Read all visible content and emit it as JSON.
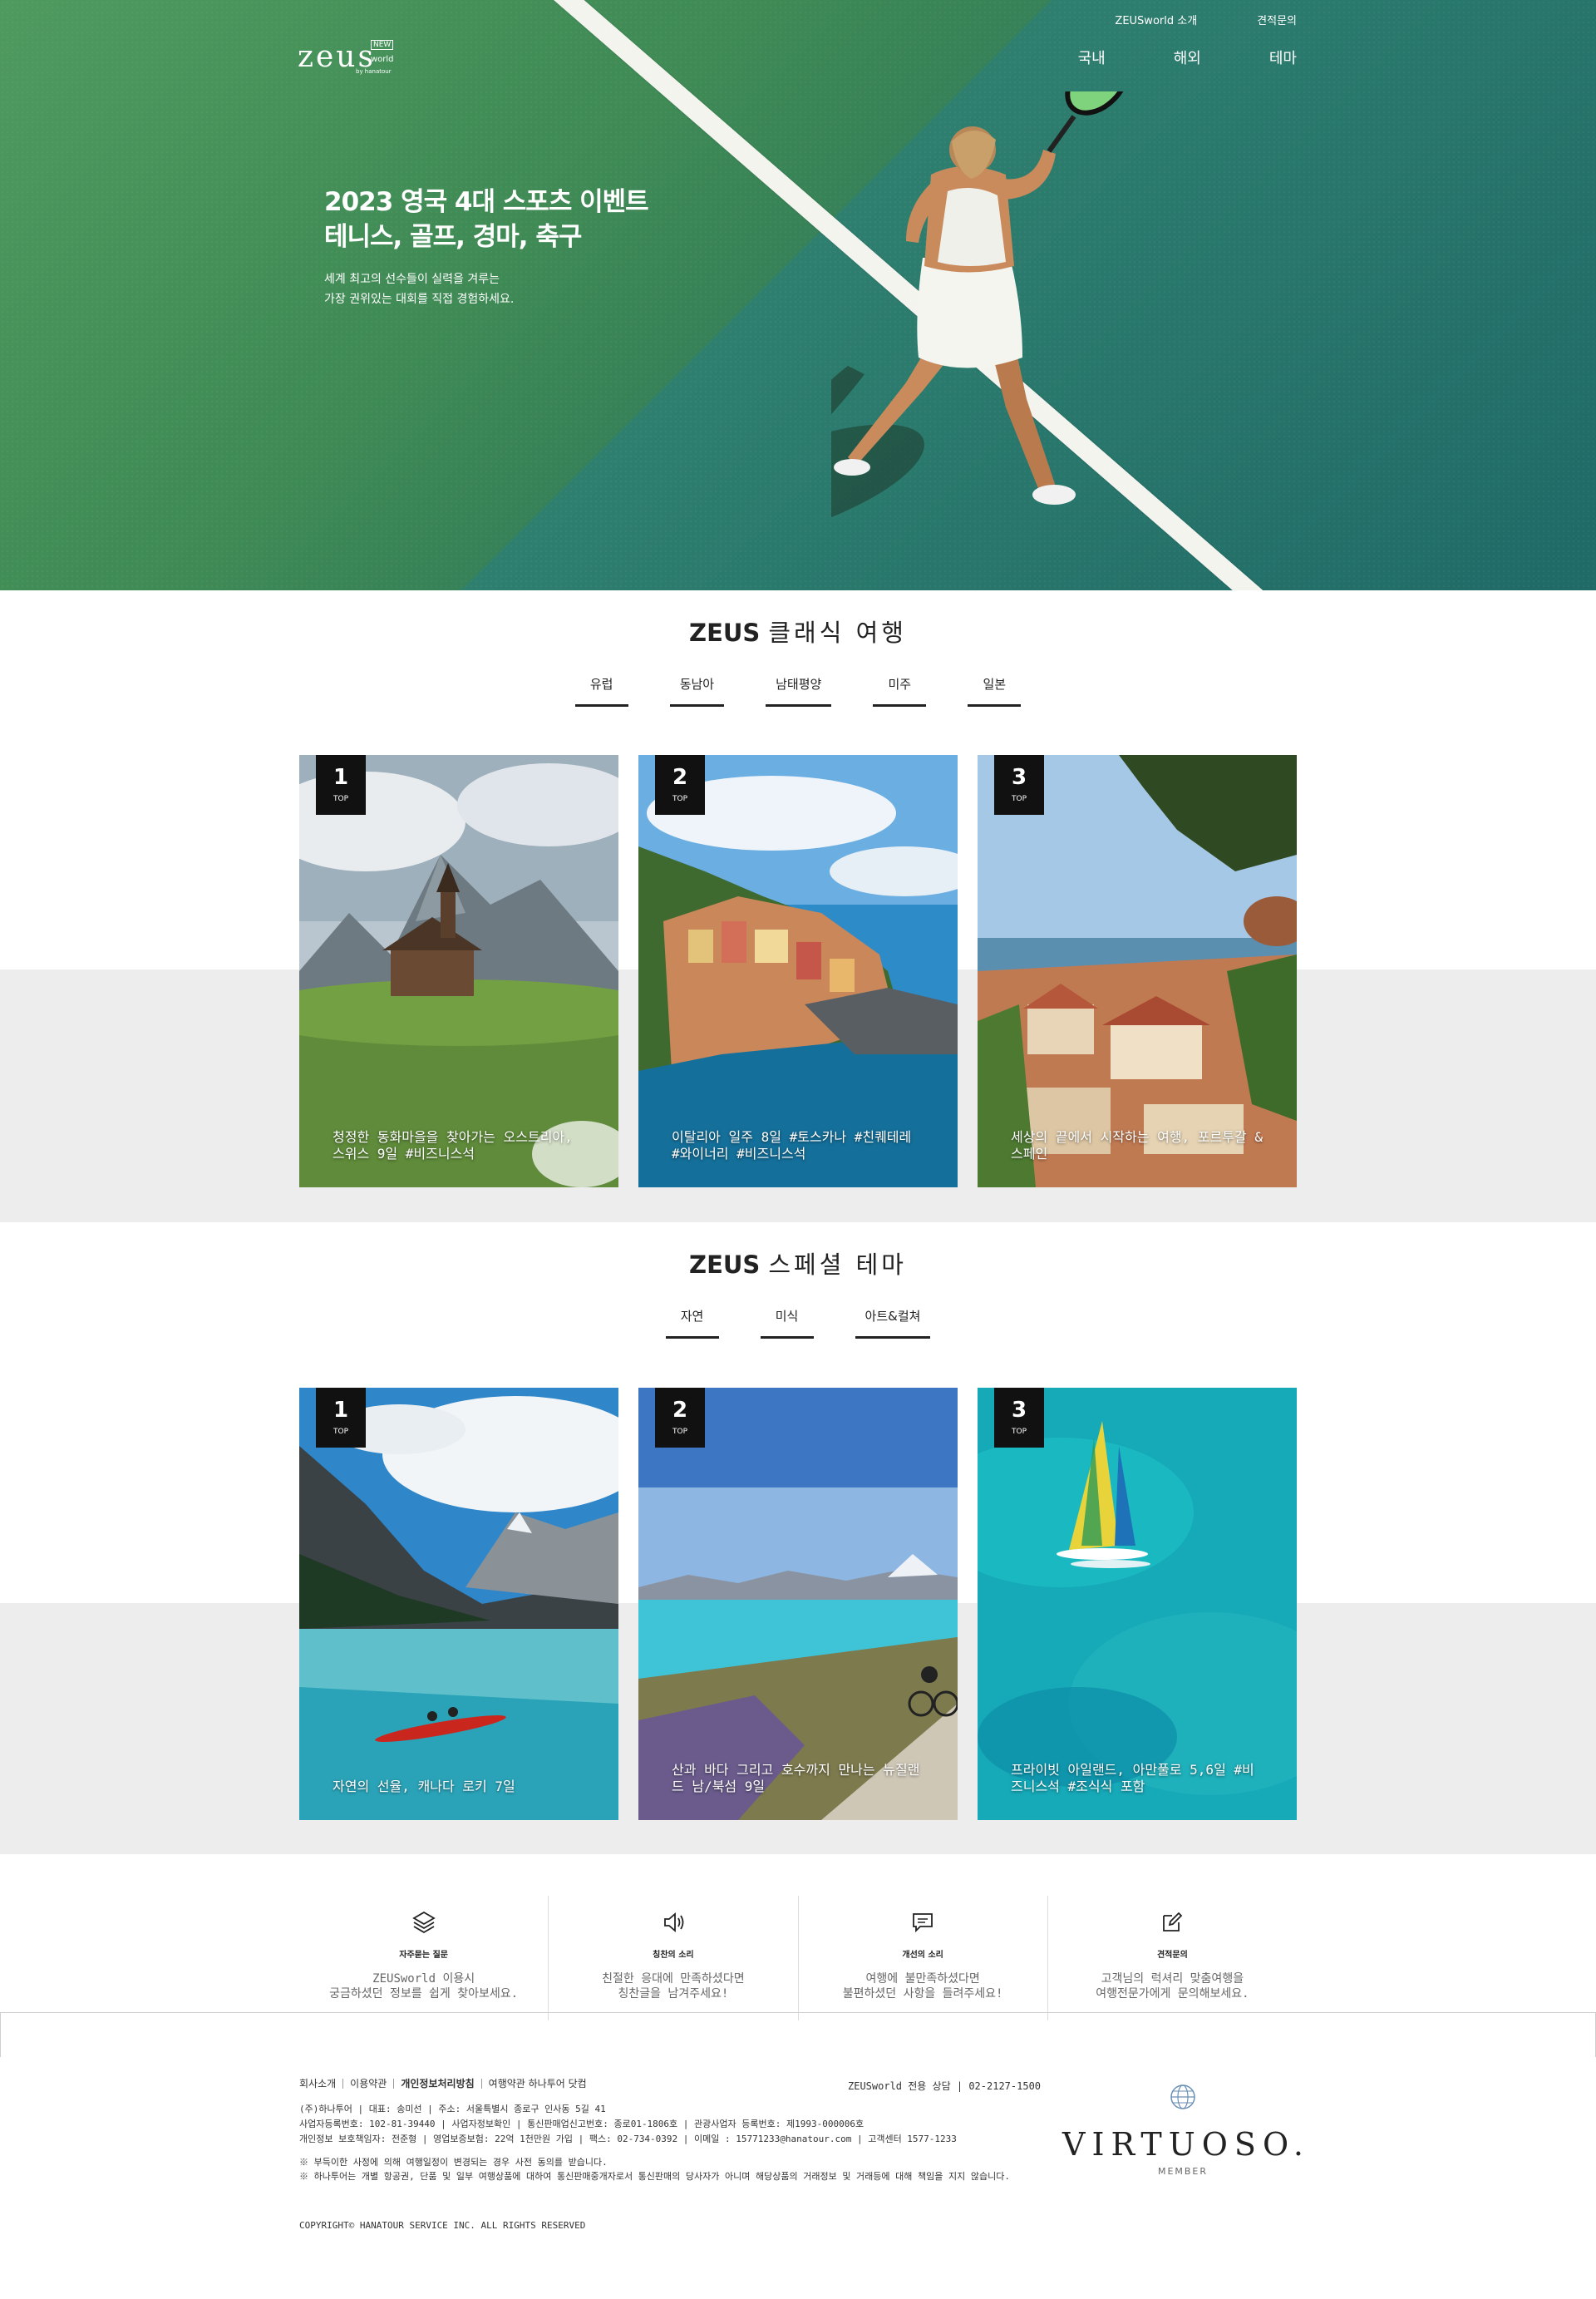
{
  "header": {
    "logo_text": "zeus",
    "logo_badge": "NEW",
    "logo_sub": "world",
    "logo_by": "by hanatour",
    "top_links": [
      "ZEUSworld 소개",
      "견적문의"
    ],
    "nav": [
      "국내",
      "해외",
      "테마"
    ]
  },
  "hero": {
    "title_line1": "2023 영국 4대 스포츠 이벤트",
    "title_line2": "테니스, 골프, 경마, 축구",
    "desc_line1": "세계 최고의 선수들이 실력을 겨루는",
    "desc_line2": "가장 권위있는 대회를 직접 경험하세요."
  },
  "classic": {
    "title_bold": "ZEUS",
    "title_rest": "클래식 여행",
    "tabs": [
      "유럽",
      "동남아",
      "남태평양",
      "미주",
      "일본"
    ],
    "cards": [
      {
        "rank": "1",
        "rank_label": "TOP",
        "caption": "청정한 동화마을을 찾아가는 오스트리아, 스위스 9일 #비즈니스석"
      },
      {
        "rank": "2",
        "rank_label": "TOP",
        "caption": "이탈리아 일주 8일 #토스카나 #친퀘테레 #와이너리 #비즈니스석"
      },
      {
        "rank": "3",
        "rank_label": "TOP",
        "caption": "세상의 끝에서 시작하는 여행, 포르투갈 & 스페인"
      }
    ]
  },
  "special": {
    "title_bold": "ZEUS",
    "title_rest": "스페셜 테마",
    "tabs": [
      "자연",
      "미식",
      "아트&컬쳐"
    ],
    "cards": [
      {
        "rank": "1",
        "rank_label": "TOP",
        "caption": "자연의 선율, 캐나다 로키 7일"
      },
      {
        "rank": "2",
        "rank_label": "TOP",
        "caption": "산과 바다 그리고 호수까지 만나는 뉴질랜드 남/북섬 9일"
      },
      {
        "rank": "3",
        "rank_label": "TOP",
        "caption": "프라이빗 아일랜드, 아만풀로 5,6일 #비즈니스석 #조식식 포함"
      }
    ]
  },
  "services": [
    {
      "title": "자주묻는 질문",
      "line1": "ZEUSworld 이용시",
      "line2": "궁금하셨던 정보를 쉽게 찾아보세요."
    },
    {
      "title": "칭찬의 소리",
      "line1": "친절한 응대에 만족하셨다면",
      "line2": "칭찬글을 남겨주세요!"
    },
    {
      "title": "개선의 소리",
      "line1": "여행에 불만족하셨다면",
      "line2": "불편하셨던 사항을 들려주세요!"
    },
    {
      "title": "견적문의",
      "line1": "고객님의 럭셔리 맞춤여행을",
      "line2": "여행전문가에게 문의해보세요."
    }
  ],
  "footer": {
    "links": [
      "회사소개",
      "이용약관",
      "개인정보처리방침",
      "여행약관 하나투어 닷컴"
    ],
    "consult_label": "ZEUSworld 전용 상담",
    "consult_phone": "02-2127-1500",
    "line1": "(주)하나투어 | 대표: 송미선 | 주소: 서울특별시 종로구 인사동 5길 41",
    "line2": "사업자등록번호: 102-81-39440 | 사업자정보확인 | 통신판매업신고번호: 종로01-1806호 | 관광사업자 등록번호: 제1993-000006호",
    "line3": "개인정보 보호책임자: 전준형 | 영업보증보험: 22억 1천만원 가입 | 팩스: 02-734-0392 | 이메일 : 15771233@hanatour.com | 고객센터 1577-1233",
    "note1": "※ 부득이한 사정에 의해 여행일정이 변경되는 경우 사전 동의를 받습니다.",
    "note2": "※ 하나투어는 개별 항공권, 단품 및 일부 여행상품에 대하여 통신판매중개자로서 통신판매의 당사자가 아니며 해당상품의 거래정보 및 거래등에 대해 책임을 지지 않습니다.",
    "copyright": "COPYRIGHT© HANATOUR SERVICE INC. ALL RIGHTS RESERVED",
    "virtuoso_word": "VIRTUOSO.",
    "virtuoso_member": "MEMBER"
  }
}
